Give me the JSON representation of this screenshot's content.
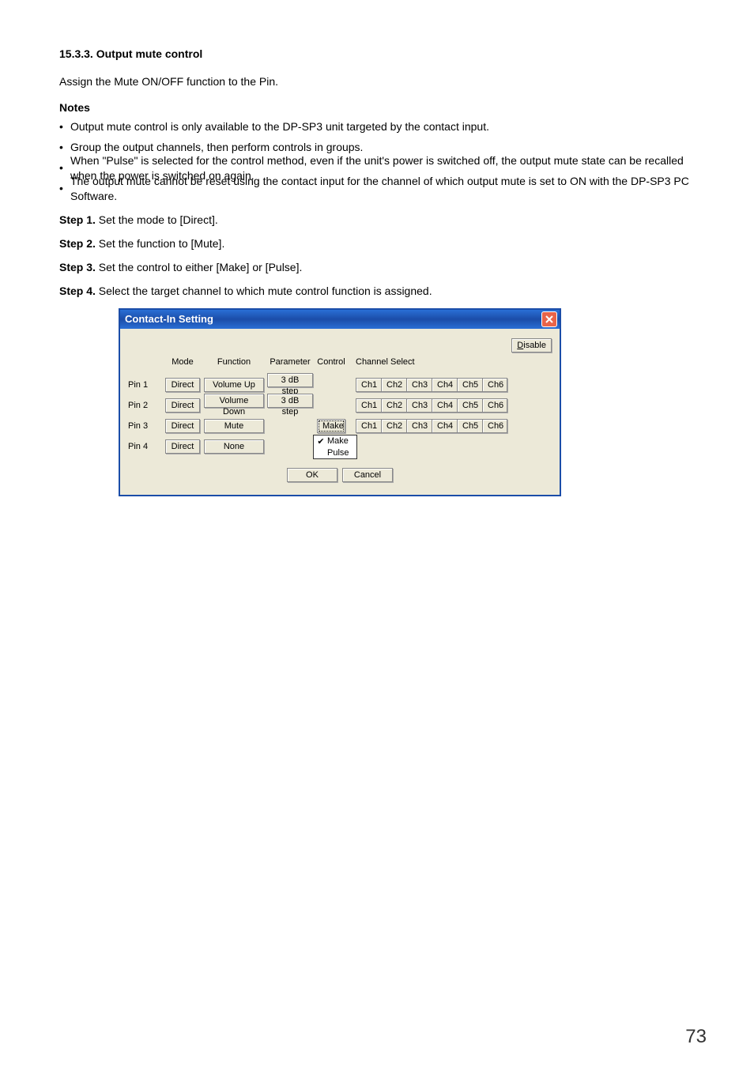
{
  "section": {
    "number": "15.3.3.",
    "title": "Output mute control"
  },
  "intro": "Assign the Mute ON/OFF function to the Pin.",
  "notes_label": "Notes",
  "notes": [
    "Output mute control is only available to the DP-SP3 unit targeted by the contact input.",
    "Group the output channels, then perform controls in groups.",
    "When \"Pulse\" is selected for the control method, even if the unit's power is switched off, the output mute state can be recalled when the power is switched on again.",
    "The output mute cannot be reset using the contact input for the channel of which output mute is set to ON with the DP-SP3 PC Software."
  ],
  "steps": [
    {
      "label": "Step 1.",
      "text": "Set the mode to [Direct]."
    },
    {
      "label": "Step 2.",
      "text": "Set the function to [Mute]."
    },
    {
      "label": "Step 3.",
      "text": "Set the control to either [Make] or [Pulse]."
    },
    {
      "label": "Step 4.",
      "text": "Select the target channel to which mute control function is assigned."
    }
  ],
  "dialog": {
    "title": "Contact-In Setting",
    "disable_prefix": "D",
    "disable_rest": "isable",
    "headers": {
      "mode": "Mode",
      "func": "Function",
      "param": "Parameter",
      "ctrl": "Control",
      "chsel": "Channel Select"
    },
    "channels": [
      "Ch1",
      "Ch2",
      "Ch3",
      "Ch4",
      "Ch5",
      "Ch6"
    ],
    "pins": [
      {
        "name": "Pin 1",
        "mode": "Direct",
        "func": "Volume Up",
        "param": "3 dB step",
        "ctrl": "",
        "ch": true
      },
      {
        "name": "Pin 2",
        "mode": "Direct",
        "func": "Volume Down",
        "param": "3 dB step",
        "ctrl": "",
        "ch": true
      },
      {
        "name": "Pin 3",
        "mode": "Direct",
        "func": "Mute",
        "param": "",
        "ctrl": "Make",
        "ch": true
      },
      {
        "name": "Pin 4",
        "mode": "Direct",
        "func": "None",
        "param": "",
        "ctrl": "",
        "ch": false
      }
    ],
    "dropdown": {
      "opt1": "Make",
      "opt2": "Pulse",
      "check": "✔"
    },
    "ok": "OK",
    "cancel": "Cancel"
  },
  "page_number": "73"
}
